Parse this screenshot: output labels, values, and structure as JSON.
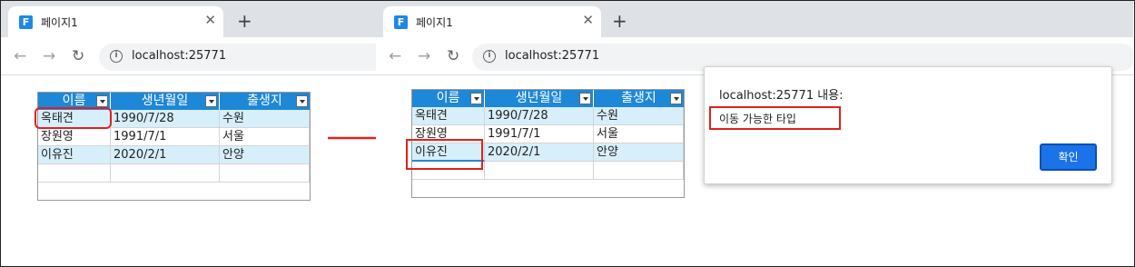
{
  "browser_left": {
    "tab_favicon": "F",
    "tab_title": "페이지1",
    "tab_close": "✕",
    "new_tab": "+",
    "back_icon": "←",
    "forward_icon": "→",
    "reload_icon": "↻",
    "url": "localhost:25771"
  },
  "browser_right": {
    "tab_favicon": "F",
    "tab_title": "페이지1",
    "tab_close": "✕",
    "new_tab": "+",
    "back_icon": "←",
    "forward_icon": "→",
    "reload_icon": "↻",
    "url": "localhost:25771"
  },
  "grid_left": {
    "columns": [
      "이름",
      "생년월일",
      "출생지"
    ],
    "rows": [
      [
        "옥태견",
        "1990/7/28",
        "수원"
      ],
      [
        "장원영",
        "1991/7/1",
        "서울"
      ],
      [
        "이유진",
        "2020/2/1",
        "안양"
      ]
    ]
  },
  "grid_right": {
    "columns": [
      "이름",
      "생년월일",
      "출생지"
    ],
    "rows": [
      [
        "옥태견",
        "1990/7/28",
        "수원"
      ],
      [
        "장원영",
        "1991/7/1",
        "서울"
      ],
      [
        "이유진",
        "2020/2/1",
        "안양"
      ]
    ]
  },
  "alert": {
    "title": "localhost:25771 내용:",
    "message": "이동 가능한 타입",
    "ok_label": "확인"
  },
  "colors": {
    "grid_header": "#1e88d8",
    "row_alt": "#d7effb",
    "highlight": "#e02020",
    "ok_button": "#1a73e8"
  }
}
